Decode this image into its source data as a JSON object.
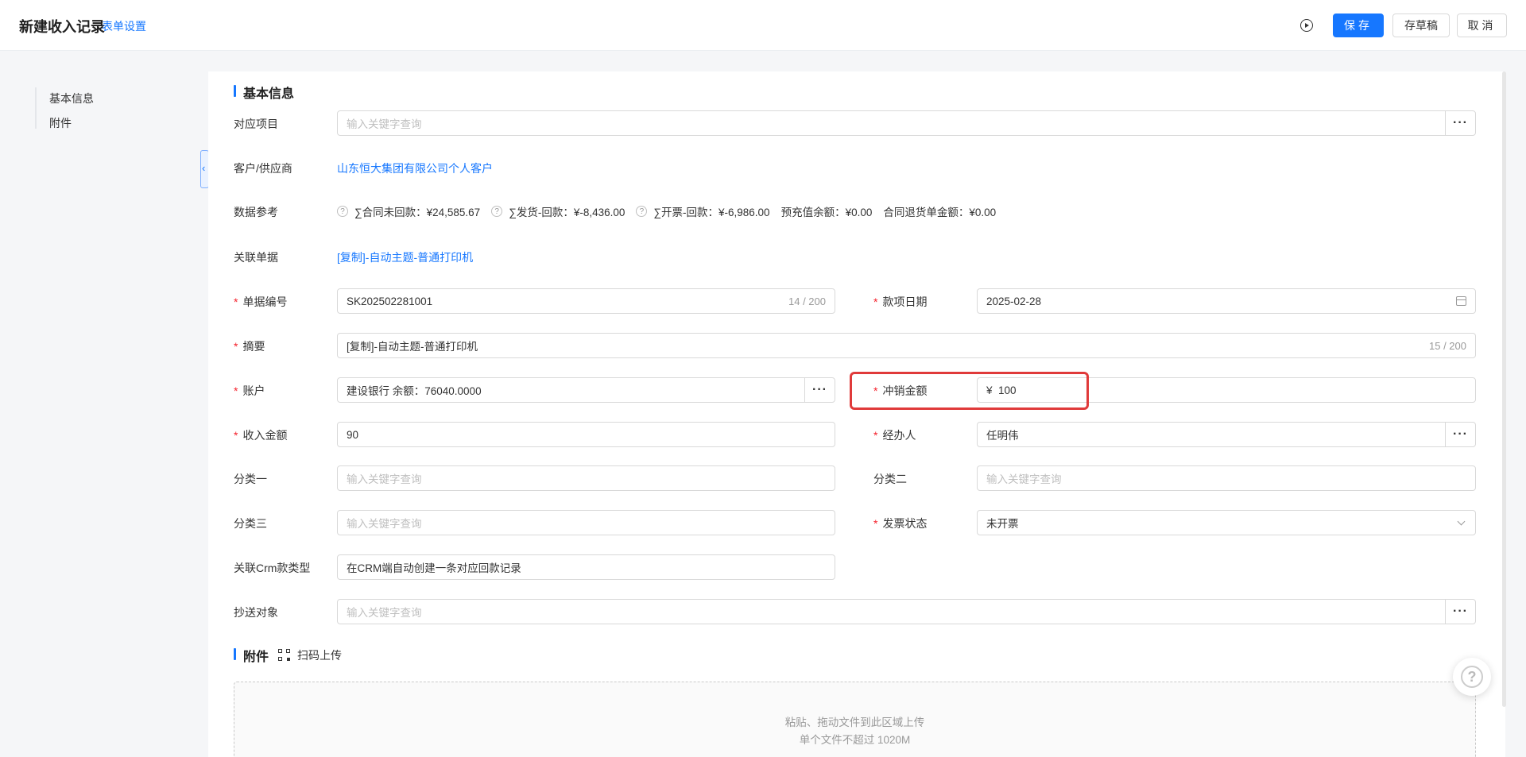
{
  "header": {
    "title": "新建收入记录",
    "settings_link": "表单设置",
    "save": "保存",
    "draft": "存草稿",
    "cancel": "取消"
  },
  "sidebar": {
    "items": [
      {
        "label": "基本信息"
      },
      {
        "label": "附件"
      }
    ]
  },
  "form": {
    "section_basic": "基本信息",
    "project": {
      "label": "对应项目",
      "placeholder": "输入关键字查询"
    },
    "customer": {
      "label": "客户/供应商",
      "value": "山东恒大集团有限公司个人客户"
    },
    "data_ref": {
      "label": "数据参考",
      "items": [
        {
          "text": "∑合同未回款：¥24,585.67",
          "icon": "question-icon"
        },
        {
          "text": "∑发货-回款：¥-8,436.00",
          "icon": "question-icon"
        },
        {
          "text": "∑开票-回款：¥-6,986.00",
          "icon": "question-icon"
        },
        {
          "text": "预充值余额：¥0.00"
        },
        {
          "text": "合同退货单金额：¥0.00"
        }
      ]
    },
    "related_doc": {
      "label": "关联单据",
      "value": "[复制]-自动主题-普通打印机"
    },
    "doc_no": {
      "label": "单据编号",
      "value": "SK202502281001",
      "count": "14 / 200"
    },
    "date": {
      "label": "款项日期",
      "value": "2025-02-28"
    },
    "summary": {
      "label": "摘要",
      "value": "[复制]-自动主题-普通打印机",
      "count": "15 / 200"
    },
    "account": {
      "label": "账户",
      "value": "建设银行 余额：76040.0000"
    },
    "writeoff": {
      "label": "冲销金额",
      "value": "¥  100"
    },
    "income": {
      "label": "收入金额",
      "value": "90"
    },
    "handler": {
      "label": "经办人",
      "value": "任明伟"
    },
    "cat1": {
      "label": "分类一",
      "placeholder": "输入关键字查询"
    },
    "cat2": {
      "label": "分类二",
      "placeholder": "输入关键字查询"
    },
    "cat3": {
      "label": "分类三",
      "placeholder": "输入关键字查询"
    },
    "invoice_status": {
      "label": "发票状态",
      "value": "未开票"
    },
    "crm_type": {
      "label": "关联Crm款类型",
      "value": "在CRM端自动创建一条对应回款记录"
    },
    "cc": {
      "label": "抄送对象",
      "placeholder": "输入关键字查询"
    },
    "section_attach": "附件",
    "scan_upload": "扫码上传",
    "upload_hint1": "粘贴、拖动文件到此区域上传",
    "upload_hint2": "单个文件不超过 1020M",
    "more": "···"
  },
  "colors": {
    "accent": "#1677ff",
    "required": "#f5222d",
    "highlight": "#e03a3a"
  }
}
